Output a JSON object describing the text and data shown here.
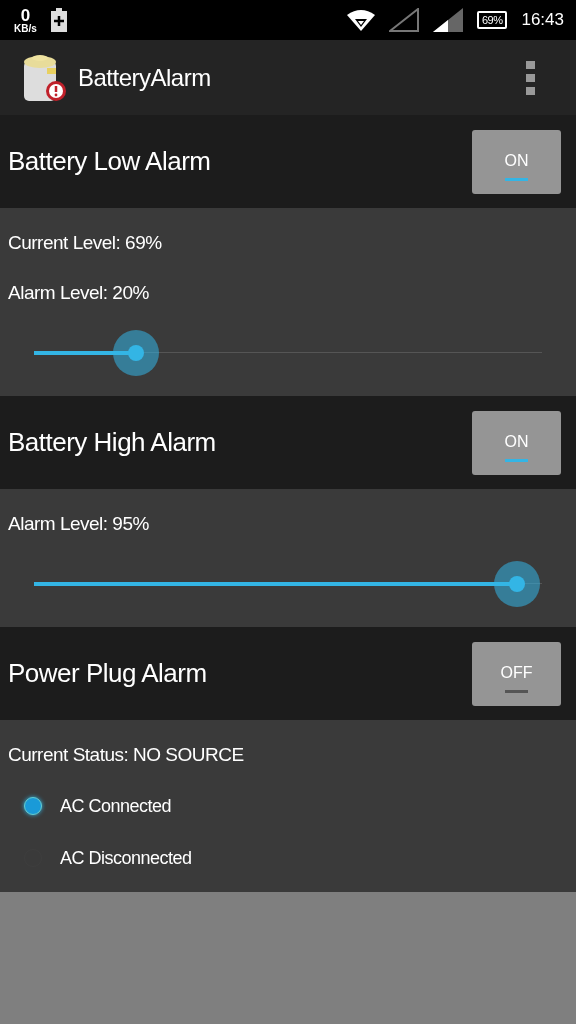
{
  "status_bar": {
    "speed_value": "0",
    "speed_unit": "KB/s",
    "battery": "69%",
    "time": "16:43"
  },
  "app_bar": {
    "title": "BatteryAlarm"
  },
  "sections": [
    {
      "title": "Battery Low Alarm",
      "toggle": {
        "label": "ON",
        "on": true
      },
      "lines": [
        "Current Level: 69%",
        "Alarm Level: 20%"
      ],
      "slider": {
        "level": 0.2
      }
    },
    {
      "title": "Battery High Alarm",
      "toggle": {
        "label": "ON",
        "on": true
      },
      "lines": [
        "Alarm Level: 95%"
      ],
      "slider": {
        "level": 0.95
      }
    },
    {
      "title": "Power Plug Alarm",
      "toggle": {
        "label": "OFF",
        "on": false
      },
      "lines": [
        "Current Status: NO SOURCE"
      ],
      "options": [
        {
          "label": "AC Connected",
          "selected": true
        },
        {
          "label": "AC Disconnected",
          "selected": false
        }
      ]
    }
  ]
}
